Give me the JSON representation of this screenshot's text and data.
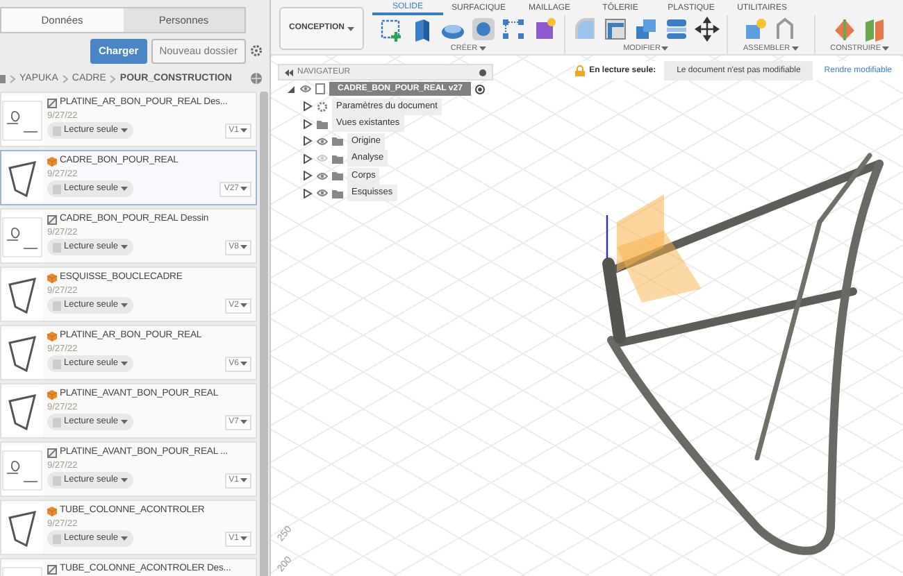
{
  "data_panel": {
    "tabs": [
      {
        "label": "Données",
        "selected": true
      },
      {
        "label": "Personnes",
        "selected": false
      }
    ],
    "upload_button": "Charger",
    "new_folder_button": "Nouveau dossier",
    "breadcrumb": [
      "YAPUKA",
      "CADRE",
      "POUR_CONSTRUCTION"
    ],
    "files": [
      {
        "kind": "drawing",
        "name": "PLATINE_AR_BON_POUR_REAL Des...",
        "date": "9/27/22",
        "access": "Lecture seule",
        "version": "V1",
        "selected": false
      },
      {
        "kind": "model",
        "name": "CADRE_BON_POUR_REAL",
        "date": "9/27/22",
        "access": "Lecture seule",
        "version": "V27",
        "selected": true
      },
      {
        "kind": "drawing",
        "name": "CADRE_BON_POUR_REAL Dessin",
        "date": "9/27/22",
        "access": "Lecture seule",
        "version": "V8",
        "selected": false
      },
      {
        "kind": "model",
        "name": "ESQUISSE_BOUCLECADRE",
        "date": "9/27/22",
        "access": "Lecture seule",
        "version": "V2",
        "selected": false
      },
      {
        "kind": "model",
        "name": "PLATINE_AR_BON_POUR_REAL",
        "date": "9/27/22",
        "access": "Lecture seule",
        "version": "V6",
        "selected": false
      },
      {
        "kind": "model",
        "name": "PLATINE_AVANT_BON_POUR_REAL",
        "date": "9/27/22",
        "access": "Lecture seule",
        "version": "V7",
        "selected": false
      },
      {
        "kind": "drawing",
        "name": "PLATINE_AVANT_BON_POUR_REAL ...",
        "date": "9/27/22",
        "access": "Lecture seule",
        "version": "V1",
        "selected": false
      },
      {
        "kind": "model",
        "name": "TUBE_COLONNE_ACONTROLER",
        "date": "9/27/22",
        "access": "Lecture seule",
        "version": "V1",
        "selected": false
      },
      {
        "kind": "drawing",
        "name": "TUBE_COLONNE_ACONTROLER Des...",
        "selected": false
      }
    ]
  },
  "toolbar": {
    "workspace": "CONCEPTION",
    "tabs": [
      {
        "label": "SOLIDE",
        "selected": true
      },
      {
        "label": "SURFACIQUE",
        "selected": false
      },
      {
        "label": "MAILLAGE",
        "selected": false
      },
      {
        "label": "TÔLERIE",
        "selected": false
      },
      {
        "label": "PLASTIQUE",
        "selected": false
      },
      {
        "label": "UTILITAIRES",
        "selected": false
      }
    ],
    "groups": [
      "CRÉER",
      "MODIFIER",
      "ASSEMBLER",
      "CONSTRUIRE"
    ]
  },
  "navigator": {
    "title": "NAVIGATEUR",
    "root": {
      "label": "CADRE_BON_POUR_REAL v27",
      "expanded": true,
      "selected": true,
      "children": [
        {
          "kind": "settings",
          "label": "Paramètres du document",
          "expanded": false,
          "selected": false
        },
        {
          "kind": "folder",
          "label": "Vues existantes",
          "expanded": false,
          "selected": false
        },
        {
          "kind": "toggle",
          "label": "Origine",
          "expanded": false,
          "visible": true,
          "selected": false
        },
        {
          "kind": "toggle",
          "label": "Analyse",
          "expanded": false,
          "visible": false,
          "selected": false
        },
        {
          "kind": "toggle",
          "label": "Corps",
          "expanded": false,
          "visible": true,
          "selected": false
        },
        {
          "kind": "toggle",
          "label": "Esquisses",
          "expanded": false,
          "visible": true,
          "selected": false
        }
      ]
    }
  },
  "read_only_notice": {
    "label": "En lecture seule:",
    "message": "Le document n'est pas modifiable",
    "action": "Rendre modifiable"
  },
  "viewport": {
    "grid_labels": [
      "250",
      "200"
    ]
  }
}
